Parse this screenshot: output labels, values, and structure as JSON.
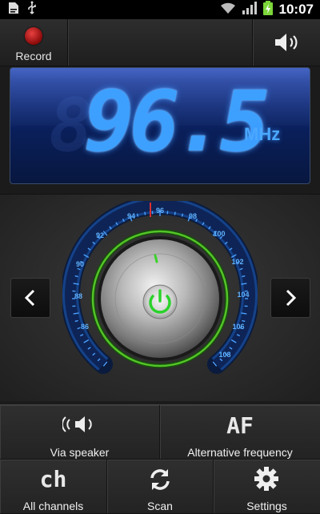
{
  "status_bar": {
    "time": "10:07"
  },
  "top_bar": {
    "record_label": "Record"
  },
  "display": {
    "frequency": "96.5",
    "unit": "MHz"
  },
  "dial": {
    "ticks": [
      "96",
      "98",
      "100",
      "102",
      "104",
      "106",
      "108",
      "94",
      "92",
      "90",
      "88",
      "86"
    ],
    "needle_color": "#d93030"
  },
  "menu": {
    "via_speaker": "Via speaker",
    "alt_frequency_icon": "AF",
    "alt_frequency": "Alternative frequency",
    "all_channels_icon": "ch",
    "all_channels": "All channels",
    "scan": "Scan",
    "settings": "Settings"
  },
  "colors": {
    "accent": "#3da0ff",
    "power": "#2bd22b",
    "record": "#c01818"
  },
  "icons": [
    "file-icon",
    "usb-icon",
    "wifi-icon",
    "signal-icon",
    "battery-charging-icon",
    "record-icon",
    "speaker-icon",
    "chevron-left-icon",
    "chevron-right-icon",
    "power-icon",
    "speaker-waves-icon",
    "refresh-icon",
    "gear-icon"
  ]
}
